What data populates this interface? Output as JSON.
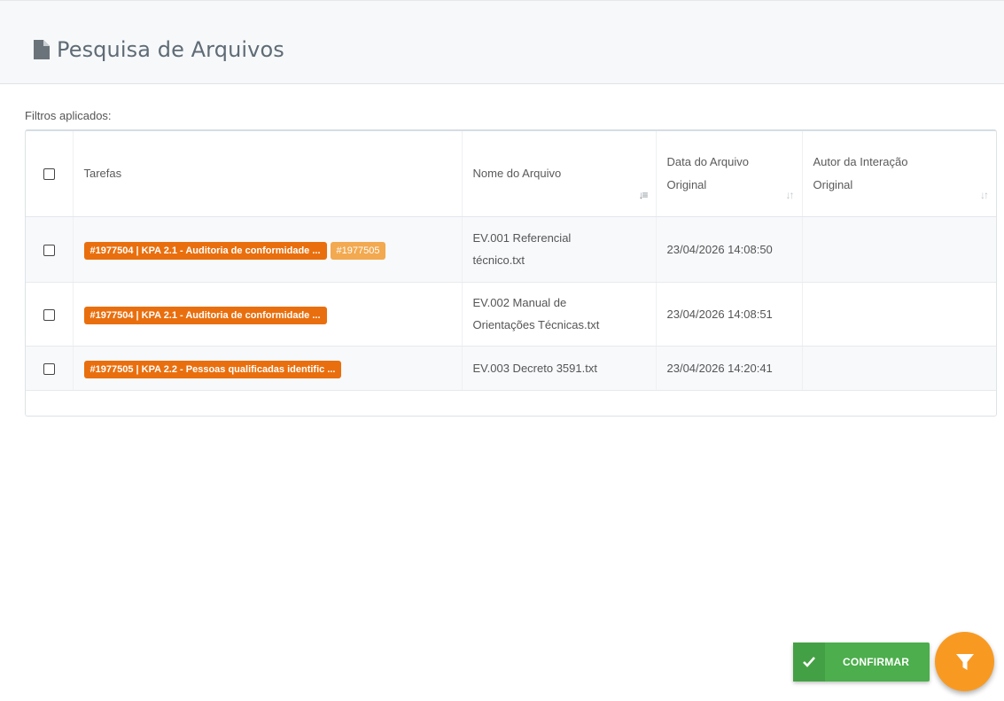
{
  "header": {
    "title": "Pesquisa de Arquivos",
    "icon": "file-icon"
  },
  "filters_label": "Filtros aplicados:",
  "table": {
    "columns": {
      "tasks": "Tarefas",
      "file_name": "Nome do Arquivo",
      "file_date": [
        "Data do Arquivo",
        "Original"
      ],
      "author": [
        "Autor da Interação",
        "Original"
      ]
    },
    "rows": [
      {
        "tags": [
          "#1977504 | KPA 2.1 - Auditoria de conformidade ...",
          "#1977505"
        ],
        "file_name": [
          "EV.001 Referencial",
          "técnico.txt"
        ],
        "date": "23/04/2026 14:08:50",
        "author": ""
      },
      {
        "tags": [
          "#1977504 | KPA 2.1 - Auditoria de conformidade ..."
        ],
        "file_name": [
          "EV.002 Manual de",
          "Orientações Técnicas.txt"
        ],
        "date": "23/04/2026 14:08:51",
        "author": ""
      },
      {
        "tags": [
          "#1977505 | KPA 2.2 - Pessoas qualificadas identific ..."
        ],
        "file_name": [
          "EV.003 Decreto 3591.txt"
        ],
        "date": "23/04/2026 14:20:41",
        "author": ""
      }
    ]
  },
  "actions": {
    "confirm_label": "CONFIRMAR",
    "confirm_icon": "check-icon",
    "filter_icon": "filter-icon"
  },
  "colors": {
    "tag_primary": "#e96f0e",
    "tag_secondary": "#f2a94f",
    "confirm_button": "#4cae4c",
    "filter_fab": "#f89a22"
  }
}
